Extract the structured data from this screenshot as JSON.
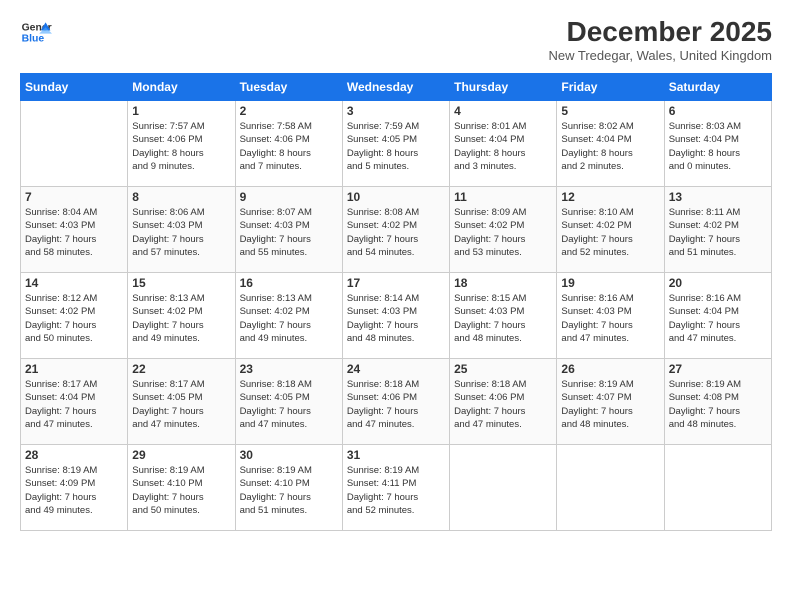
{
  "logo": {
    "line1": "General",
    "line2": "Blue"
  },
  "title": "December 2025",
  "subtitle": "New Tredegar, Wales, United Kingdom",
  "weekdays": [
    "Sunday",
    "Monday",
    "Tuesday",
    "Wednesday",
    "Thursday",
    "Friday",
    "Saturday"
  ],
  "weeks": [
    [
      {
        "day": "",
        "info": ""
      },
      {
        "day": "1",
        "info": "Sunrise: 7:57 AM\nSunset: 4:06 PM\nDaylight: 8 hours\nand 9 minutes."
      },
      {
        "day": "2",
        "info": "Sunrise: 7:58 AM\nSunset: 4:06 PM\nDaylight: 8 hours\nand 7 minutes."
      },
      {
        "day": "3",
        "info": "Sunrise: 7:59 AM\nSunset: 4:05 PM\nDaylight: 8 hours\nand 5 minutes."
      },
      {
        "day": "4",
        "info": "Sunrise: 8:01 AM\nSunset: 4:04 PM\nDaylight: 8 hours\nand 3 minutes."
      },
      {
        "day": "5",
        "info": "Sunrise: 8:02 AM\nSunset: 4:04 PM\nDaylight: 8 hours\nand 2 minutes."
      },
      {
        "day": "6",
        "info": "Sunrise: 8:03 AM\nSunset: 4:04 PM\nDaylight: 8 hours\nand 0 minutes."
      }
    ],
    [
      {
        "day": "7",
        "info": "Sunrise: 8:04 AM\nSunset: 4:03 PM\nDaylight: 7 hours\nand 58 minutes."
      },
      {
        "day": "8",
        "info": "Sunrise: 8:06 AM\nSunset: 4:03 PM\nDaylight: 7 hours\nand 57 minutes."
      },
      {
        "day": "9",
        "info": "Sunrise: 8:07 AM\nSunset: 4:03 PM\nDaylight: 7 hours\nand 55 minutes."
      },
      {
        "day": "10",
        "info": "Sunrise: 8:08 AM\nSunset: 4:02 PM\nDaylight: 7 hours\nand 54 minutes."
      },
      {
        "day": "11",
        "info": "Sunrise: 8:09 AM\nSunset: 4:02 PM\nDaylight: 7 hours\nand 53 minutes."
      },
      {
        "day": "12",
        "info": "Sunrise: 8:10 AM\nSunset: 4:02 PM\nDaylight: 7 hours\nand 52 minutes."
      },
      {
        "day": "13",
        "info": "Sunrise: 8:11 AM\nSunset: 4:02 PM\nDaylight: 7 hours\nand 51 minutes."
      }
    ],
    [
      {
        "day": "14",
        "info": "Sunrise: 8:12 AM\nSunset: 4:02 PM\nDaylight: 7 hours\nand 50 minutes."
      },
      {
        "day": "15",
        "info": "Sunrise: 8:13 AM\nSunset: 4:02 PM\nDaylight: 7 hours\nand 49 minutes."
      },
      {
        "day": "16",
        "info": "Sunrise: 8:13 AM\nSunset: 4:02 PM\nDaylight: 7 hours\nand 49 minutes."
      },
      {
        "day": "17",
        "info": "Sunrise: 8:14 AM\nSunset: 4:03 PM\nDaylight: 7 hours\nand 48 minutes."
      },
      {
        "day": "18",
        "info": "Sunrise: 8:15 AM\nSunset: 4:03 PM\nDaylight: 7 hours\nand 48 minutes."
      },
      {
        "day": "19",
        "info": "Sunrise: 8:16 AM\nSunset: 4:03 PM\nDaylight: 7 hours\nand 47 minutes."
      },
      {
        "day": "20",
        "info": "Sunrise: 8:16 AM\nSunset: 4:04 PM\nDaylight: 7 hours\nand 47 minutes."
      }
    ],
    [
      {
        "day": "21",
        "info": "Sunrise: 8:17 AM\nSunset: 4:04 PM\nDaylight: 7 hours\nand 47 minutes."
      },
      {
        "day": "22",
        "info": "Sunrise: 8:17 AM\nSunset: 4:05 PM\nDaylight: 7 hours\nand 47 minutes."
      },
      {
        "day": "23",
        "info": "Sunrise: 8:18 AM\nSunset: 4:05 PM\nDaylight: 7 hours\nand 47 minutes."
      },
      {
        "day": "24",
        "info": "Sunrise: 8:18 AM\nSunset: 4:06 PM\nDaylight: 7 hours\nand 47 minutes."
      },
      {
        "day": "25",
        "info": "Sunrise: 8:18 AM\nSunset: 4:06 PM\nDaylight: 7 hours\nand 47 minutes."
      },
      {
        "day": "26",
        "info": "Sunrise: 8:19 AM\nSunset: 4:07 PM\nDaylight: 7 hours\nand 48 minutes."
      },
      {
        "day": "27",
        "info": "Sunrise: 8:19 AM\nSunset: 4:08 PM\nDaylight: 7 hours\nand 48 minutes."
      }
    ],
    [
      {
        "day": "28",
        "info": "Sunrise: 8:19 AM\nSunset: 4:09 PM\nDaylight: 7 hours\nand 49 minutes."
      },
      {
        "day": "29",
        "info": "Sunrise: 8:19 AM\nSunset: 4:10 PM\nDaylight: 7 hours\nand 50 minutes."
      },
      {
        "day": "30",
        "info": "Sunrise: 8:19 AM\nSunset: 4:10 PM\nDaylight: 7 hours\nand 51 minutes."
      },
      {
        "day": "31",
        "info": "Sunrise: 8:19 AM\nSunset: 4:11 PM\nDaylight: 7 hours\nand 52 minutes."
      },
      {
        "day": "",
        "info": ""
      },
      {
        "day": "",
        "info": ""
      },
      {
        "day": "",
        "info": ""
      }
    ]
  ]
}
